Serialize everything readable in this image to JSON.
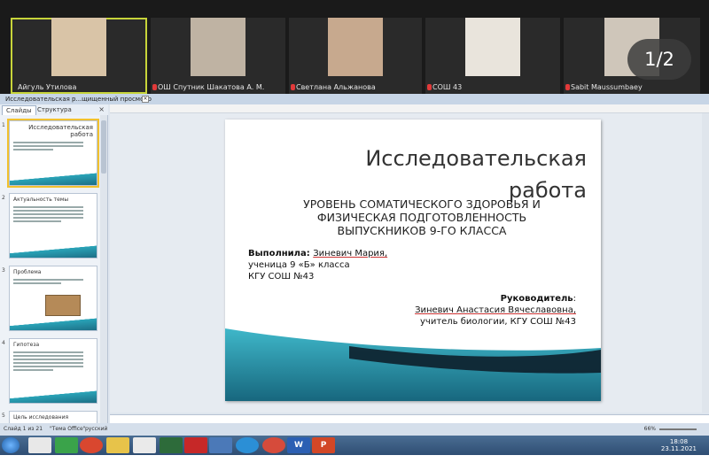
{
  "meeting": {
    "pager": "1/2",
    "participants": [
      {
        "name": "Айгуль Утилова",
        "active": true,
        "muted": false
      },
      {
        "name": "ОШ Спутник Шакатова А. М.",
        "active": false,
        "muted": true
      },
      {
        "name": "Светлана Альжанова",
        "active": false,
        "muted": true
      },
      {
        "name": "СОШ 43",
        "active": false,
        "muted": true
      },
      {
        "name": "Sabit Maussumbaey",
        "active": false,
        "muted": true
      }
    ]
  },
  "window": {
    "title": "Исследовательская р...щищенный просмотр"
  },
  "panel": {
    "tabs": [
      "Слайды",
      "Структура"
    ],
    "active_tab": "Слайды"
  },
  "thumbnails": [
    {
      "num": "1",
      "title": "Исследовательская работа",
      "selected": true
    },
    {
      "num": "2",
      "title": "Актуальность темы",
      "selected": false
    },
    {
      "num": "3",
      "title": "Проблема",
      "selected": false
    },
    {
      "num": "4",
      "title": "Гипотеза",
      "selected": false
    },
    {
      "num": "5",
      "title": "Цель исследования",
      "selected": false
    }
  ],
  "slide": {
    "title_line1": "Исследовательская",
    "title_line2": "работа",
    "subtitle_line1": "Уровень соматического здоровья и",
    "subtitle_line2": "физическая подготовленность",
    "subtitle_line3": "выпускников 9-го класса",
    "author_label": "Выполнила",
    "author_name": "Зиневич Мария,",
    "author_role": "ученица 9 «Б» класса",
    "author_school": "КГУ СОШ №43",
    "supervisor_label": "Руководитель",
    "supervisor_name": "Зиневич Анастасия Вячеславовна,",
    "supervisor_role": "учитель биологии, КГУ СОШ №43"
  },
  "status": {
    "slide_info": "Слайд 1 из 21",
    "theme": "\"Тема Office\"",
    "language": "русский",
    "zoom": "66%"
  },
  "clock": {
    "time": "18:08",
    "date": "23.11.2021"
  },
  "colors": {
    "accent_yellow": "#f2c12e",
    "wave_teal": "#2aa4b8",
    "wave_dark": "#1d6f86"
  }
}
